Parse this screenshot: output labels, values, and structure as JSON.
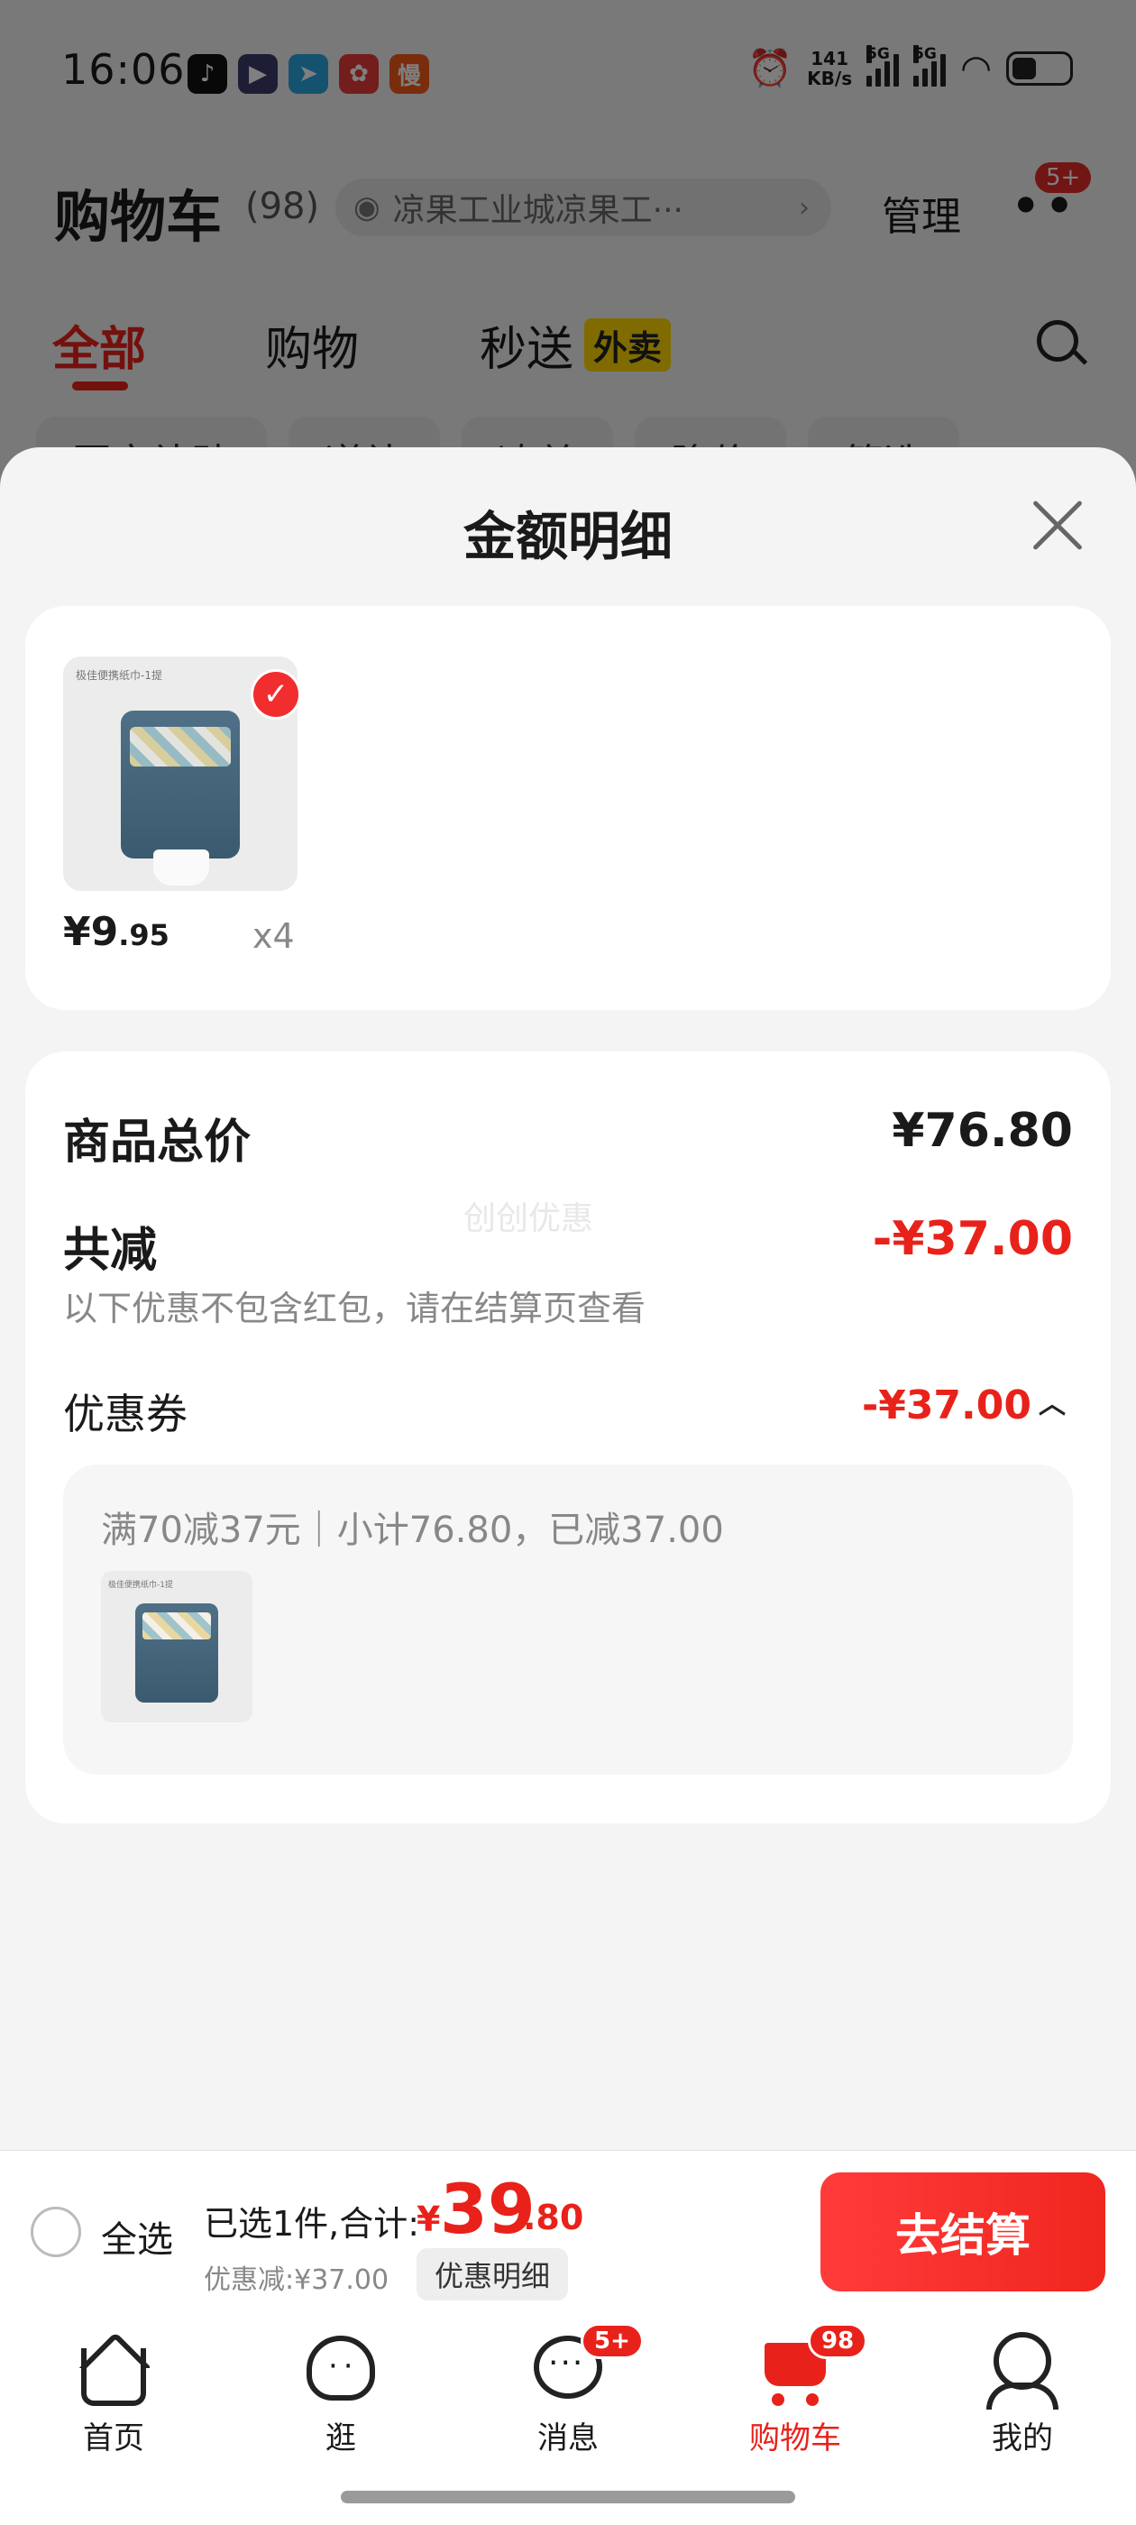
{
  "status_bar": {
    "time": "16:06",
    "net_speed_value": "141",
    "net_speed_unit": "KB/s",
    "network_1": "5G",
    "network_2": "5G",
    "app_icons": [
      "tiktok-icon",
      "video-app-icon",
      "telegram-icon",
      "recipe-app-icon",
      "slow-app-icon"
    ],
    "slow_app_char": "慢"
  },
  "cart_header": {
    "title": "购物车",
    "count": "(98)",
    "address": "凉果工业城凉果工···",
    "manage": "管理",
    "more_badge": "5+"
  },
  "tabs": [
    {
      "label": "全部",
      "active": true
    },
    {
      "label": "购物",
      "active": false
    },
    {
      "label": "秒送",
      "active": false
    }
  ],
  "takeaway_tag": "外卖",
  "filter_chips": [
    "国家补贴",
    "逆补",
    "凑单",
    "降价",
    "筛选"
  ],
  "sheet": {
    "title": "金额明细",
    "product": {
      "price_yen": "¥",
      "price_int": "9",
      "price_dec": ".95",
      "quantity": "x4",
      "thumb_text": "极佳便携纸巾-1提"
    },
    "summary": {
      "total_label": "商品总价",
      "total_value": "¥76.80",
      "reduce_label": "共减",
      "reduce_value": "-¥37.00",
      "watermark": "创创优惠",
      "note": "以下优惠不包含红包，请在结算页查看",
      "coupon_label": "优惠券",
      "coupon_value": "-¥37.00",
      "coupon_desc": "满70减37元｜小计76.80，已减37.00"
    }
  },
  "checkout": {
    "select_all": "全选",
    "selected_info": "已选1件,合计:",
    "total_yen": "¥",
    "total_int": "39",
    "total_dec": ".80",
    "discount_line": "优惠减:¥37.00",
    "detail_button": "优惠明细",
    "checkout_button": "去结算"
  },
  "nav": [
    {
      "label": "首页",
      "icon": "home-icon"
    },
    {
      "label": "逛",
      "icon": "explore-icon"
    },
    {
      "label": "消息",
      "icon": "message-icon",
      "badge": "5+"
    },
    {
      "label": "购物车",
      "icon": "cart-icon",
      "badge": "98",
      "active": true
    },
    {
      "label": "我的",
      "icon": "profile-icon"
    }
  ],
  "colors": {
    "accent_red": "#e8221a",
    "takeaway_yellow": "#ffd700"
  }
}
